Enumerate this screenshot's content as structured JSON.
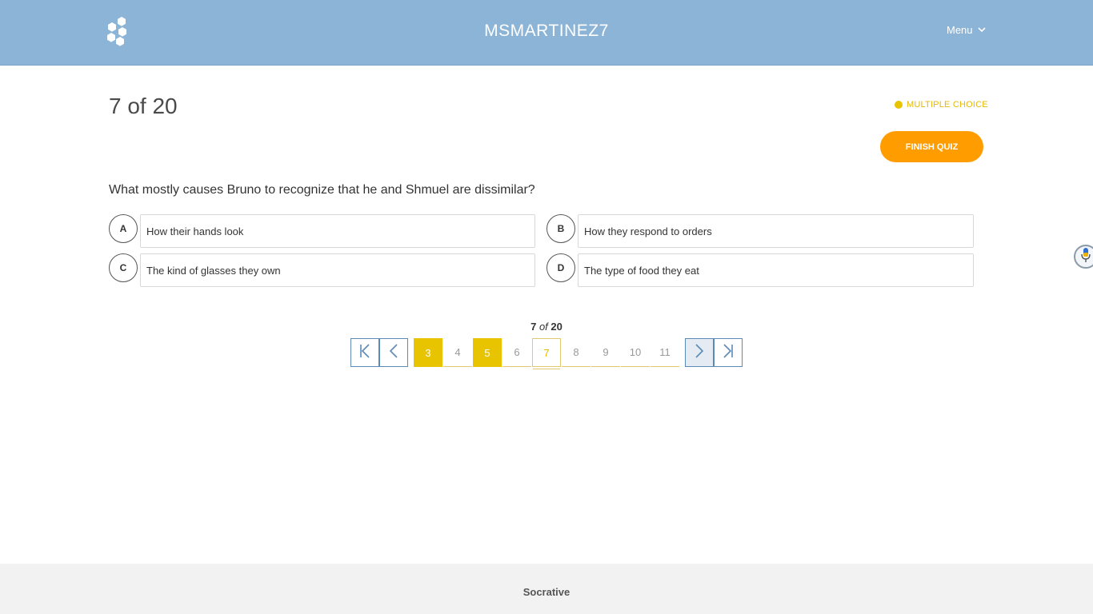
{
  "header": {
    "room_name": "MSMARTINEZ7",
    "menu_label": "Menu",
    "logo_icon": "hexagon-cluster-logo"
  },
  "question": {
    "count_title": "7 of 20",
    "type_label": "MULTIPLE CHOICE",
    "type_color": "#e8c400",
    "finish_label": "FINISH QUIZ",
    "finish_color": "#ff9c00",
    "text": "What mostly causes Bruno to recognize that he and Shmuel are dissimilar?",
    "answers": [
      {
        "letter": "A",
        "text": "How their hands look"
      },
      {
        "letter": "B",
        "text": "How they respond to orders"
      },
      {
        "letter": "C",
        "text": "The kind of glasses they own"
      },
      {
        "letter": "D",
        "text": "The type of food they eat"
      }
    ]
  },
  "pagination": {
    "current": "7",
    "of_word": "of",
    "total": "20",
    "pages": [
      {
        "label": "3",
        "state": "answered"
      },
      {
        "label": "4",
        "state": "unanswered"
      },
      {
        "label": "5",
        "state": "answered"
      },
      {
        "label": "6",
        "state": "unanswered"
      },
      {
        "label": "7",
        "state": "current"
      },
      {
        "label": "8",
        "state": "unanswered"
      },
      {
        "label": "9",
        "state": "unanswered"
      },
      {
        "label": "10",
        "state": "unanswered"
      },
      {
        "label": "11",
        "state": "unanswered"
      }
    ],
    "nav_icons": [
      "first-page-icon",
      "prev-page-icon",
      "next-page-icon",
      "last-page-icon"
    ],
    "accent_color": "#5a8ab5"
  },
  "footer": {
    "brand": "Socrative"
  }
}
